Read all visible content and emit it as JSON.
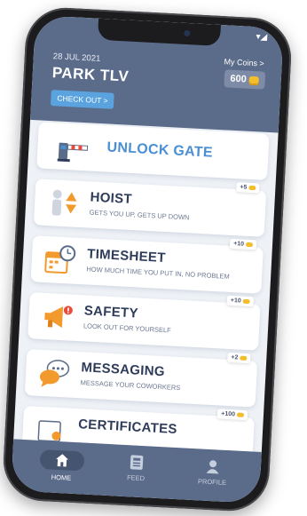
{
  "header": {
    "date": "28 JUL 2021",
    "site": "PARK TLV",
    "checkout_label": "CHECK OUT >",
    "coins_label": "My Coins >",
    "coins_value": "600"
  },
  "menu": [
    {
      "title": "UNLOCK GATE",
      "subtitle": "",
      "reward": "",
      "icon": "gate-barrier-icon"
    },
    {
      "title": "HOIST",
      "subtitle": "GETS YOU UP, GETS UP DOWN",
      "reward": "+5",
      "icon": "hoist-worker-icon"
    },
    {
      "title": "TIMESHEET",
      "subtitle": "HOW MUCH TIME YOU PUT IN, NO PROBLEM",
      "reward": "+10",
      "icon": "calendar-clock-icon"
    },
    {
      "title": "SAFETY",
      "subtitle": "LOOK OUT FOR YOURSELF",
      "reward": "+10",
      "icon": "megaphone-icon"
    },
    {
      "title": "MESSAGING",
      "subtitle": "MESSAGE YOUR COWORKERS",
      "reward": "+2",
      "icon": "chat-bubbles-icon"
    },
    {
      "title": "CERTIFICATES",
      "subtitle": "",
      "reward": "+100",
      "icon": "certificate-icon"
    }
  ],
  "tabs": [
    {
      "label": "HOME",
      "icon": "home-icon",
      "active": true
    },
    {
      "label": "FEED",
      "icon": "feed-icon",
      "active": false
    },
    {
      "label": "PROFILE",
      "icon": "profile-icon",
      "active": false
    }
  ],
  "colors": {
    "header_bg": "#5b6b8a",
    "accent_blue": "#4a8fd3",
    "coin_gold": "#f3bd2c",
    "icon_orange": "#f39a2e"
  }
}
